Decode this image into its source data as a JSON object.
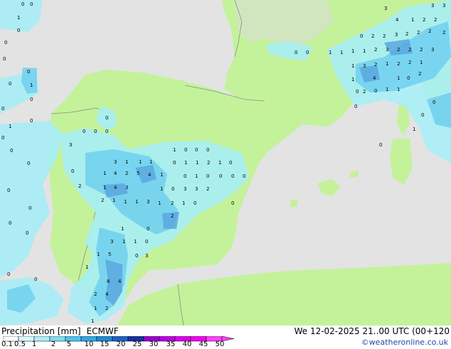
{
  "title": {
    "label": "Precipitation [mm]",
    "model": "ECMWF",
    "valid_time": "We 12-02-2025 21..00 UTC (00+120"
  },
  "credit": "©weatheronline.co.uk",
  "legend": {
    "labels": [
      "0.1",
      "0.5",
      "1",
      "2",
      "5",
      "10",
      "15",
      "20",
      "25",
      "30",
      "35",
      "40",
      "45",
      "50"
    ],
    "colors": [
      "#ffffff",
      "#d8f8fc",
      "#b0eef8",
      "#80dcf0",
      "#50c4ec",
      "#30a8e4",
      "#2088d8",
      "#2060c8",
      "#1830a0",
      "#9800d0",
      "#b800e0",
      "#d800e8",
      "#f000f0",
      "#ff40ff"
    ]
  },
  "colors": {
    "sea": "#e3e3e3",
    "land_in_domain": "#c4f29a",
    "land_outside": "#dcdcdc",
    "border": "#8c8c8c",
    "precip_light": "#a8eef6",
    "precip_mid": "#70d0ee",
    "precip_heavy": "#5aa8e0"
  },
  "values": {
    "atlantic_north": [
      "0",
      "0",
      "1",
      "0",
      "0"
    ],
    "atlantic_west": [
      "0",
      "0",
      "0",
      "1",
      "0",
      "0",
      "0",
      "0",
      "1",
      "0",
      "0",
      "0",
      "0",
      "0",
      "0",
      "0",
      "0"
    ],
    "galicia": [
      "3",
      "0",
      "0",
      "0",
      "0",
      "0"
    ],
    "central": [
      "1",
      "0",
      "0",
      "0",
      "3",
      "1",
      "1",
      "1",
      "0",
      "1",
      "1",
      "2",
      "1",
      "0",
      "1",
      "4",
      "2",
      "5",
      "4",
      "1",
      "0",
      "1",
      "0",
      "0",
      "0",
      "0"
    ],
    "west_central": [
      "2",
      "1",
      "4",
      "3",
      "1",
      "0",
      "3",
      "3",
      "2",
      "2",
      "1",
      "1",
      "1",
      "3",
      "1",
      "2",
      "1",
      "0"
    ],
    "south": [
      "2",
      "1",
      "0",
      "3",
      "1",
      "1",
      "0",
      "0",
      "3",
      "1",
      "5",
      "1",
      "8",
      "4",
      "2",
      "4",
      "1",
      "2",
      "1"
    ],
    "mediterranean": [
      "0",
      "0",
      "0",
      "0",
      "0"
    ],
    "north_italy": [
      "1",
      "0",
      "2",
      "2",
      "3",
      "2",
      "2",
      "2",
      "1",
      "1",
      "1",
      "2",
      "3",
      "2",
      "2",
      "2",
      "3",
      "4",
      "3",
      "3",
      "1",
      "2",
      "2",
      "2",
      "3"
    ],
    "italy_south": [
      "1",
      "3",
      "2",
      "1",
      "2",
      "2",
      "1",
      "1",
      "4",
      "1",
      "0",
      "2",
      "0",
      "2",
      "0",
      "1",
      "1",
      "0",
      "0",
      "1"
    ]
  }
}
